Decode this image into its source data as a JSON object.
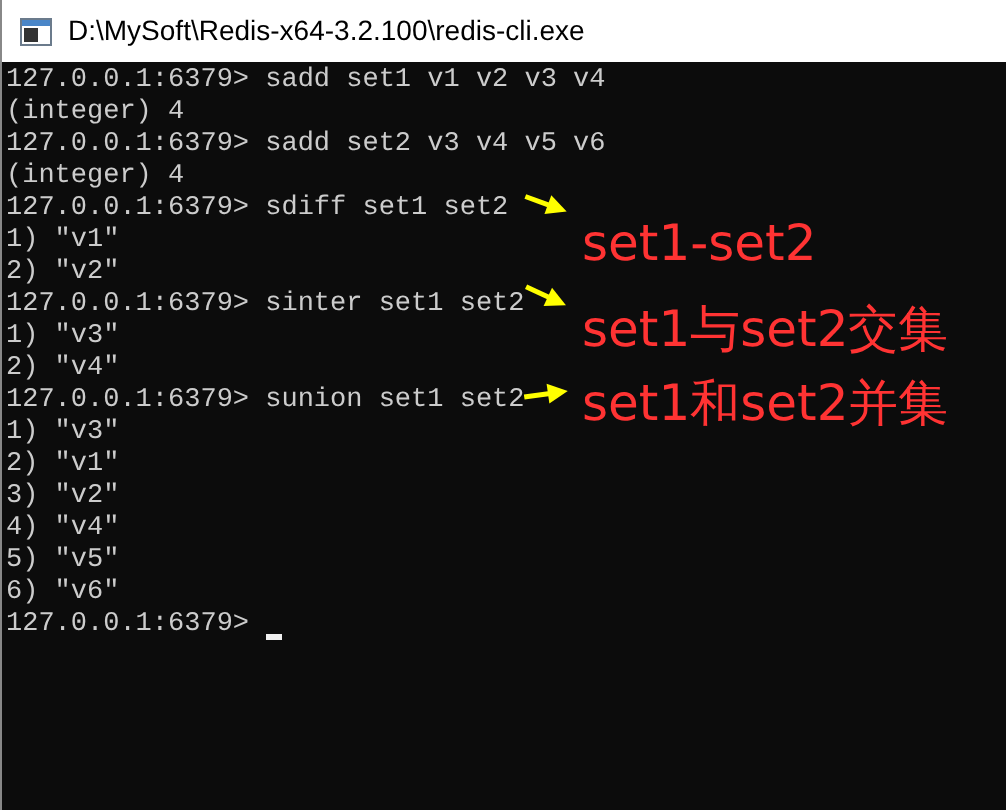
{
  "window": {
    "title": "D:\\MySoft\\Redis-x64-3.2.100\\redis-cli.exe"
  },
  "console": {
    "lines": [
      "127.0.0.1:6379> sadd set1 v1 v2 v3 v4",
      "(integer) 4",
      "127.0.0.1:6379> sadd set2 v3 v4 v5 v6",
      "(integer) 4",
      "127.0.0.1:6379> sdiff set1 set2",
      "1) \"v1\"",
      "2) \"v2\"",
      "127.0.0.1:6379> sinter set1 set2",
      "1) \"v3\"",
      "2) \"v4\"",
      "127.0.0.1:6379> sunion set1 set2",
      "1) \"v3\"",
      "2) \"v1\"",
      "3) \"v2\"",
      "4) \"v4\"",
      "5) \"v5\"",
      "6) \"v6\"",
      "127.0.0.1:6379> "
    ],
    "cursor": true
  },
  "annotations": [
    {
      "text": "set1-set2"
    },
    {
      "text": "set1与set2交集"
    },
    {
      "text": "set1和set2并集"
    }
  ]
}
